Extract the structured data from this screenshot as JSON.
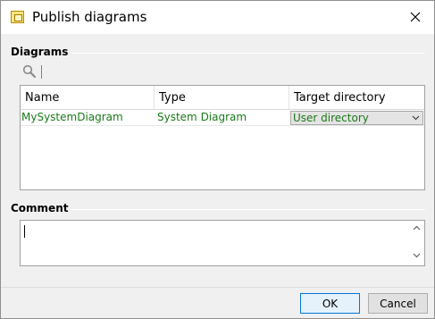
{
  "window": {
    "title": "Publish diagrams",
    "icon": "diagram-window-icon",
    "close_icon": "close-icon"
  },
  "diagrams": {
    "section_label": "Diagrams",
    "search_icon": "search-icon",
    "columns": [
      "Name",
      "Type",
      "Target directory"
    ],
    "rows": [
      {
        "name": "MySystemDiagram",
        "type": "System Diagram",
        "target": "User directory"
      }
    ],
    "row_text_color": "#1a7a1a"
  },
  "comment": {
    "section_label": "Comment",
    "value": ""
  },
  "buttons": {
    "ok": "OK",
    "cancel": "Cancel"
  }
}
